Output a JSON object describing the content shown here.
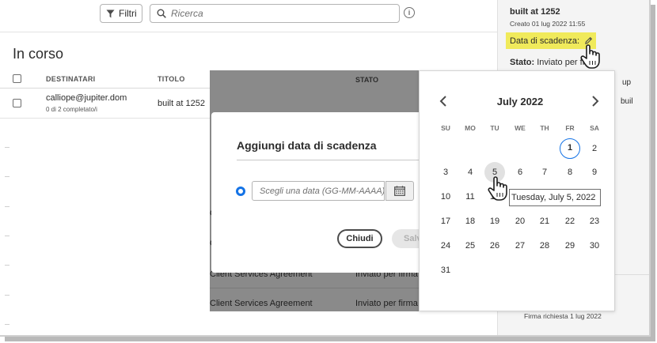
{
  "toolbar": {
    "filter_label": "Filtri",
    "search_placeholder": "Ricerca",
    "info_label": "i"
  },
  "list": {
    "section_title": "In corso",
    "columns": {
      "recipients": "DESTINATARI",
      "title": "TITOLO",
      "status": "STATO"
    },
    "rows": [
      {
        "recipient": "calliope@jupiter.dom",
        "progress": "0 di 2 completato/i",
        "title": "built at 1252"
      }
    ]
  },
  "background_rows": [
    {
      "title": "Client Services Agreement",
      "status": "Inviato per firma"
    },
    {
      "title": "Client Services Agreement",
      "status": "Inviato per firma"
    }
  ],
  "details_panel": {
    "title": "built at 1252",
    "created": "Creato 01 lug 2022 11:55",
    "deadline_label": "Data di scadenza:",
    "status_label": "Stato:",
    "status_value": "Inviato per fi",
    "fragment_1": "up",
    "fragment_2": "buil",
    "signature_requested": "Firma richiesta 1 lug 2022"
  },
  "modal": {
    "title": "Aggiungi data di scadenza",
    "date_placeholder": "Scegli una data (GG-MM-AAAA)",
    "close_label": "Chiudi",
    "save_label": "Salv"
  },
  "calendar": {
    "month_label": "July 2022",
    "weekdays": [
      "SU",
      "MO",
      "TU",
      "WE",
      "TH",
      "FR",
      "SA"
    ],
    "first_weekday_index": 5,
    "days_in_month": 31,
    "today": 1,
    "hovered_day": 5,
    "tooltip": "Tuesday, July 5, 2022",
    "accent_color": "#1473e6"
  },
  "colors": {
    "highlight": "#f0ea5b",
    "overlay": "#8a8a8a",
    "accent": "#1473e6"
  }
}
